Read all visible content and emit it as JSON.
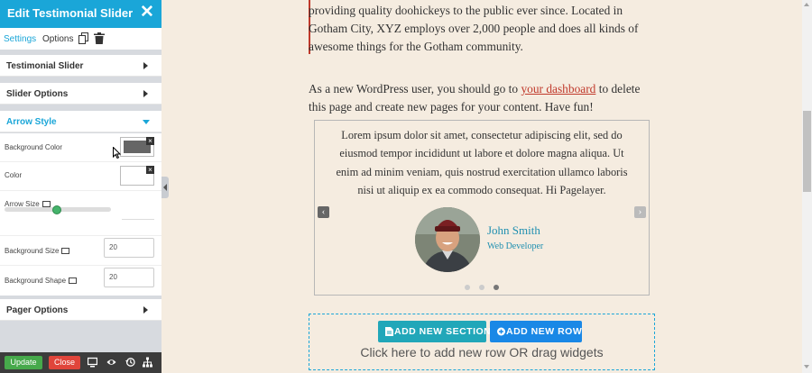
{
  "panel": {
    "title": "Edit Testimonial Slider",
    "close_glyph": "✕",
    "tabs": {
      "settings": "Settings",
      "options": "Options"
    },
    "sections": {
      "testimonial_slider": "Testimonial Slider",
      "slider_options": "Slider Options",
      "arrow_style": "Arrow Style",
      "pager_options": "Pager Options"
    },
    "fields": {
      "background_color": {
        "label": "Background Color",
        "value": "#666666"
      },
      "color": {
        "label": "Color",
        "value": "#ffffff"
      },
      "arrow_size": {
        "label": "Arrow Size",
        "level_percent": 50
      },
      "background_size": {
        "label": "Background Size",
        "value": "20"
      },
      "background_shape": {
        "label": "Background Shape",
        "value": "20"
      }
    },
    "footer": {
      "update": "Update",
      "close": "Close"
    },
    "icons": [
      "copy-icon",
      "trash-icon",
      "monitor-icon",
      "eye-icon",
      "history-icon",
      "sitemap-icon"
    ],
    "accent_color": "#1aa6d8"
  },
  "page": {
    "intro_lines": [
      "providing quality doohickeys to the public ever since. Located in",
      "Gotham City, XYZ employs over 2,000 people and does all kinds of",
      "awesome things for the Gotham community."
    ],
    "note": {
      "before_link": "As a new WordPress user, you should go to ",
      "link": "your dashboard",
      "after_link": " to delete",
      "line2": "this page and create new pages for your content. Have fun!"
    },
    "testimonial": {
      "text_lines": [
        "Lorem ipsum dolor sit amet, consectetur adipiscing elit, sed do",
        "eiusmod tempor incididunt ut labore et dolore magna aliqua. Ut",
        "enim ad minim veniam, quis nostrud exercitation ullamco laboris",
        "nisi ut aliquip ex ea commodo consequat. Hi Pagelayer."
      ],
      "name": "John Smith",
      "role": "Web Developer",
      "prev_glyph": "‹",
      "next_glyph": "›",
      "pager_count": 3,
      "active_pager": 3
    },
    "add_area": {
      "add_section": "ADD NEW SECTION",
      "add_row": "ADD NEW ROW",
      "hint": "Click here to add new row OR drag widgets"
    }
  }
}
